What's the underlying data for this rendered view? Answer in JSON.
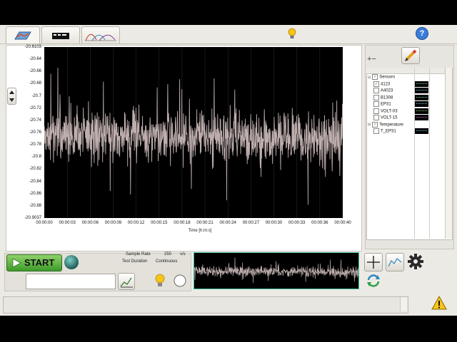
{
  "toolbar": {
    "tabs": [
      {
        "name": "tab-config",
        "icon": "map-icon"
      },
      {
        "name": "tab-hardware",
        "icon": "daq-device-icon"
      },
      {
        "name": "tab-analysis",
        "icon": "curves-icon"
      }
    ],
    "help_label": "?"
  },
  "chart": {
    "y_ticks": [
      "-20.6103",
      "-20.64",
      "-20.66",
      "-20.68",
      "-20.7",
      "-20.72",
      "-20.74",
      "-20.76",
      "-20.78",
      "-20.8",
      "-20.82",
      "-20.84",
      "-20.86",
      "-20.88",
      "-20.9037"
    ],
    "x_ticks": [
      "00:00:00",
      "00:00:03",
      "00:00:06",
      "00:00:09",
      "00:00:12",
      "00:00:15",
      "00:00:18",
      "00:00:21",
      "00:00:24",
      "00:00:27",
      "00:00:30",
      "00:00:33",
      "00:00:36",
      "00:00:40"
    ],
    "x_label": "Time [h:m:s]",
    "colors": {
      "background": "#000000",
      "signal": "#bfaeae",
      "grid": "#3a3a3a"
    }
  },
  "sensors_tree": {
    "groups": [
      {
        "label": "Sensors",
        "checked": true,
        "items": [
          {
            "label": "4123",
            "checked": true,
            "color": "#7fe0b0"
          },
          {
            "label": "A4023",
            "checked": false,
            "color": "#7fd0e8"
          },
          {
            "label": "B1308",
            "checked": false,
            "color": "#7fe0b0"
          },
          {
            "label": "EP31",
            "checked": false,
            "color": "#7fd0e8"
          },
          {
            "label": "VOLT-03",
            "checked": false,
            "color": "#8fe87f"
          },
          {
            "label": "VOLT-15",
            "checked": false,
            "color": "#e07fe0"
          }
        ]
      },
      {
        "label": "Temperature",
        "checked": true,
        "items": [
          {
            "label": "T_EP31",
            "checked": false,
            "color": "#7fd0e8"
          }
        ]
      }
    ]
  },
  "controls": {
    "start_label": "START",
    "sample_rate_label": "Sample Rate",
    "sample_rate_value": "250",
    "sample_rate_unit": "s/s",
    "test_duration_label": "Test Duration",
    "test_duration_value": "Continuous",
    "message_value": ""
  },
  "status": {
    "warning_icon": "warning-icon"
  }
}
